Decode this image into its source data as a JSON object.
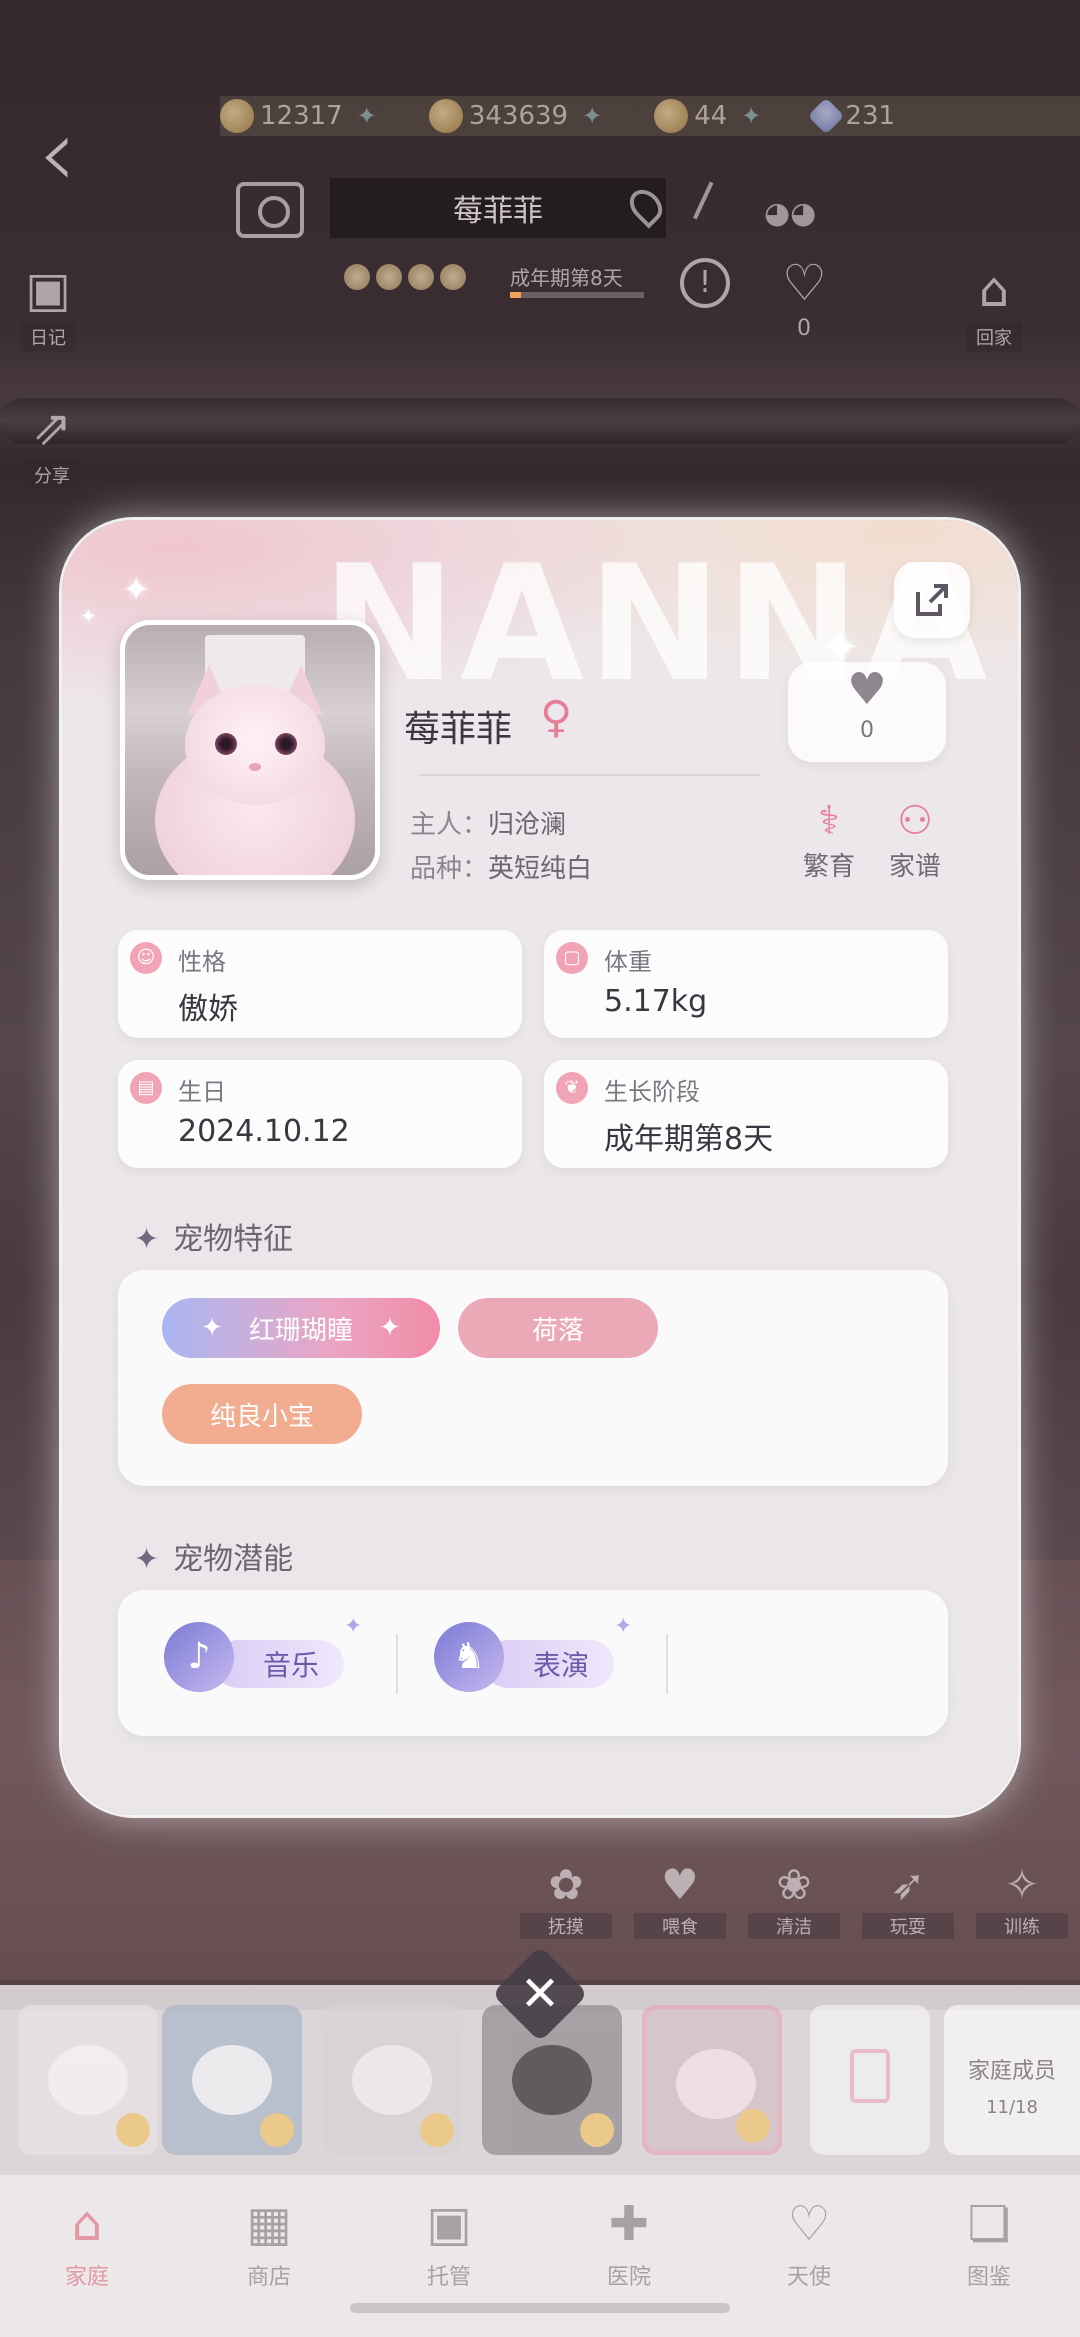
{
  "hud": {
    "currencies": [
      {
        "icon": "acorn-icon",
        "value": "12317"
      },
      {
        "icon": "coin-icon",
        "value": "343639"
      },
      {
        "icon": "fish-icon",
        "value": "44"
      },
      {
        "icon": "diamond-icon",
        "value": "231"
      }
    ],
    "pet_name_plate": "莓菲菲",
    "stage_mini": "成年期第8天",
    "stage_progress": 0.08,
    "heart_count": "0",
    "left_diary_label": "日记",
    "left_share_label": "分享",
    "right_home_label": "回家"
  },
  "card": {
    "watermark": "NANNA",
    "pet_name": "莓菲菲",
    "gender_symbol": "♀",
    "like_count": "0",
    "owner_key": "主人：",
    "owner_value": "归沧澜",
    "breed_key": "品种：",
    "breed_value": "英短纯白",
    "breed_btn_label": "繁育",
    "family_tree_label": "家谱",
    "stats": [
      {
        "key": "性格",
        "value": "傲娇"
      },
      {
        "key": "体重",
        "value": "5.17kg"
      },
      {
        "key": "生日",
        "value": "2024.10.12"
      },
      {
        "key": "生长阶段",
        "value": "成年期第8天"
      }
    ],
    "traits_title": "宠物特征",
    "traits": [
      "红珊瑚瞳",
      "荷落",
      "纯良小宝"
    ],
    "talents_title": "宠物潜能",
    "talents": [
      {
        "label": "音乐",
        "icon": "music-note-icon"
      },
      {
        "label": "表演",
        "icon": "horse-icon"
      }
    ]
  },
  "actions": [
    "抚摸",
    "喂食",
    "清洁",
    "玩耍",
    "训练"
  ],
  "strip": {
    "family_growth_label": "家庭成员",
    "family_growth_count": "11/18"
  },
  "nav": [
    {
      "label": "家庭",
      "icon": "home-icon",
      "active": true
    },
    {
      "label": "商店",
      "icon": "shop-icon",
      "active": false
    },
    {
      "label": "托管",
      "icon": "briefcase-icon",
      "active": false
    },
    {
      "label": "医院",
      "icon": "hospital-icon",
      "active": false
    },
    {
      "label": "天使",
      "icon": "angel-icon",
      "active": false
    },
    {
      "label": "图鉴",
      "icon": "book-icon",
      "active": false
    }
  ],
  "colors": {
    "accent_pink": "#e77e98",
    "text_dark": "#3b3540",
    "trait_pink": "#eba8b6",
    "trait_orange": "#f2ad90"
  }
}
